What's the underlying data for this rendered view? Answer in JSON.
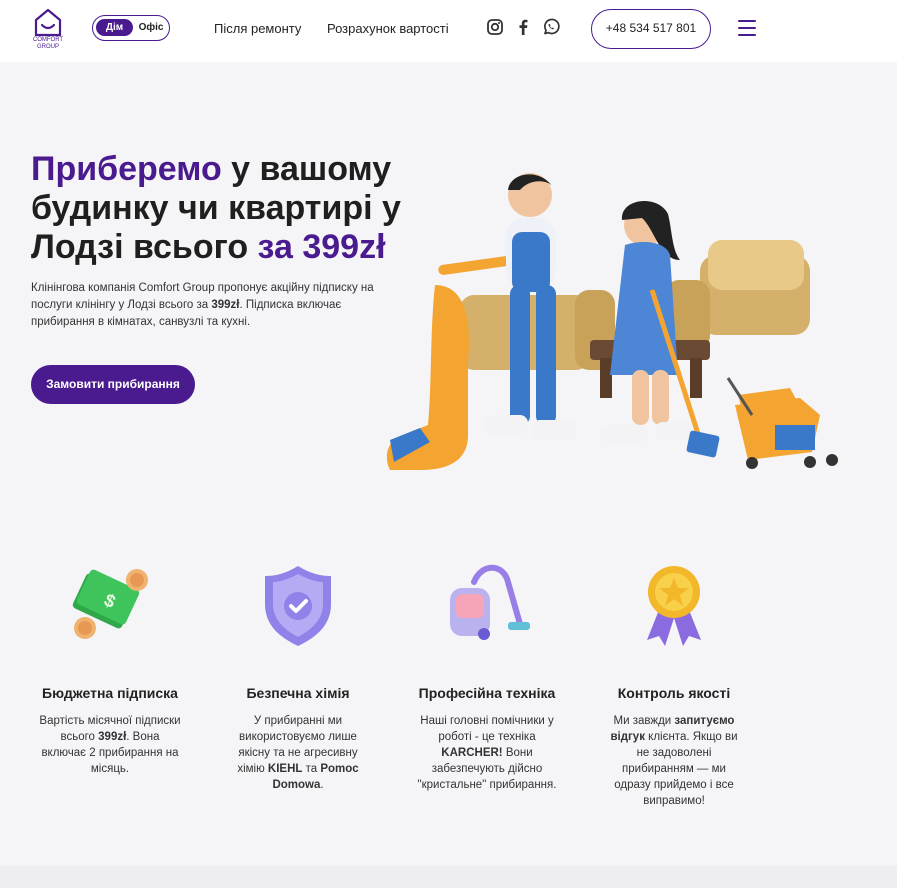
{
  "header": {
    "logo_text_1": "COMFORT",
    "logo_text_2": "GROUP",
    "toggle_active": "Дім",
    "toggle_inactive": "Офіс",
    "nav": [
      "Після ремонту",
      "Розрахунок вартості"
    ],
    "phone": "+48 534 517 801",
    "icons": [
      "instagram-icon",
      "facebook-icon",
      "whatsapp-icon",
      "menu-icon"
    ]
  },
  "hero": {
    "title_accent": "Приберемо",
    "title_mid": " у вашому будинку чи квартирі у Лодзі всього ",
    "title_price": "за 399zł",
    "lead_1": "Клінінгова компанія Comfort Group пропонує акційну підписку на послуги клінінгу у Лодзі всього за ",
    "lead_price": "399zł",
    "lead_2": ". Підписка включає прибирання в кімнатах, санвузлі та кухні.",
    "cta": "Замовити прибирання"
  },
  "features": [
    {
      "icon": "money-icon",
      "title": "Бюджетна підписка",
      "text_1": "Вартість місячної підписки всього ",
      "bold": "399zł",
      "text_2": ". Вона включає 2 прибирання на місяць."
    },
    {
      "icon": "shield-check-icon",
      "title": "Безпечна хімія",
      "text_1": "У прибиранні ми використовуємо лише якісну та не агресивну хімію ",
      "bold": "KIEHL",
      "text_2": " та ",
      "bold2": "Pomoc Domowa",
      "text_3": "."
    },
    {
      "icon": "vacuum-icon",
      "title": "Професійна техніка",
      "text_1": "Наші головні помічники у роботі - це техніка ",
      "bold": "KARCHER!",
      "text_2": " Вони забезпечують дійсно \"кристальне\" прибирання."
    },
    {
      "icon": "medal-icon",
      "title": "Контроль якості",
      "text_1": "Ми завжди ",
      "bold": "запитуємо відгук",
      "text_2": " клієнта. Якщо ви не задоволені прибиранням — ми одразу прийдемо і все виправимо!"
    }
  ],
  "colors": {
    "accent": "#4a1a8f"
  }
}
